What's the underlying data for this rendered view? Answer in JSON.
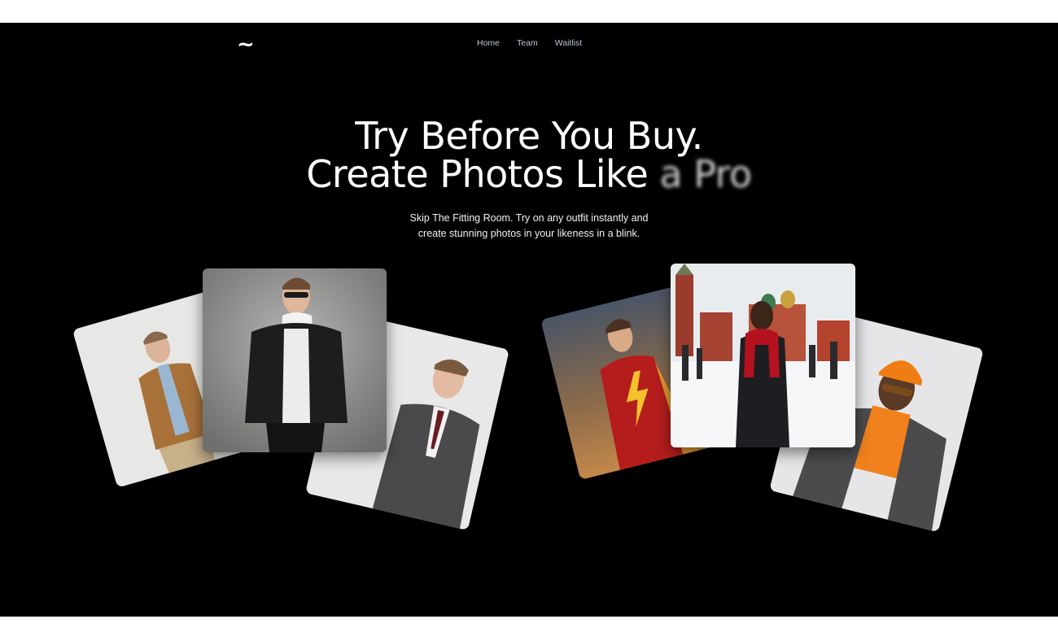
{
  "logo": {
    "glyph": "~",
    "icon": "tilde-logo-icon"
  },
  "nav": {
    "items": [
      "Home",
      "Team",
      "Waitlist"
    ]
  },
  "hero": {
    "headline_line1": "Try Before You Buy.",
    "headline_line2_clear": "Create Photos Like",
    "headline_line2_blurred": "a Pro",
    "subtitle_line1": "Skip The Fitting Room. Try on any outfit instantly and",
    "subtitle_line2": "create stunning photos in your likeness in a blink."
  },
  "gallery": {
    "left": [
      "man-tan-jacket-photo",
      "man-black-bomber-photo",
      "man-grey-suit-photo"
    ],
    "right": [
      "superhero-costume-photo",
      "woman-red-square-snow-photo",
      "man-orange-beanie-photo"
    ]
  },
  "colors": {
    "background": "#000000",
    "text": "#ffffff",
    "nav_text": "#b9c6d9"
  }
}
